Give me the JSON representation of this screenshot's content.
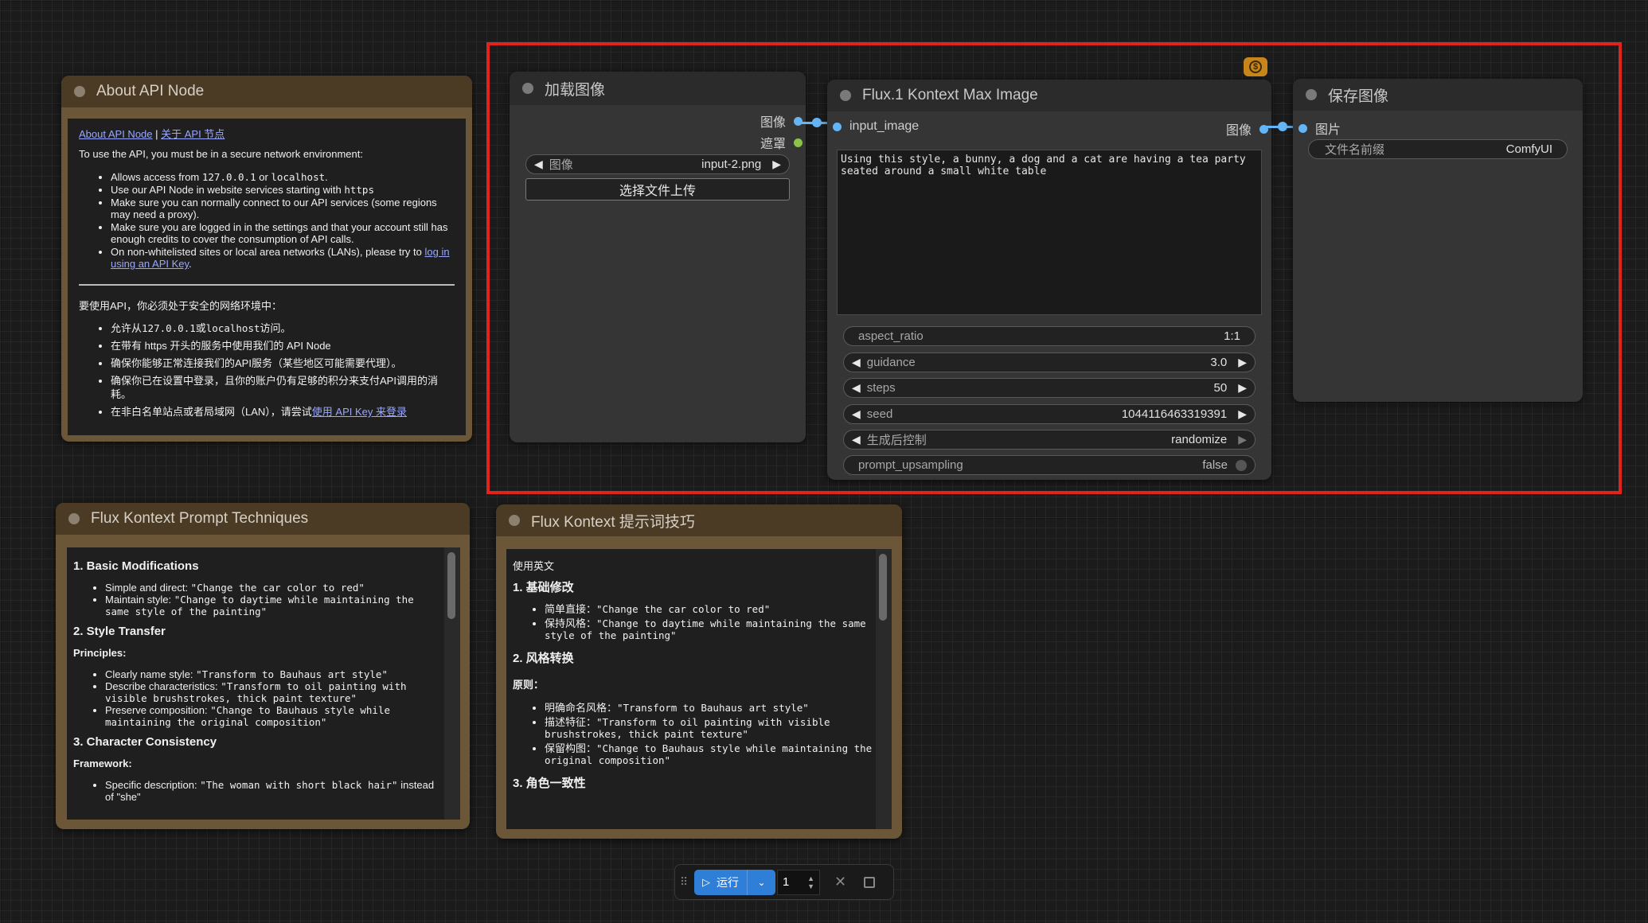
{
  "about_node": {
    "title": "About API Node",
    "link_en": "About API Node",
    "link_sep": " | ",
    "link_cn": "关于 API 节点",
    "intro": "To use the API, you must be in a secure network environment:",
    "items": [
      {
        "pre": "Allows access from ",
        "code1": "127.0.0.1",
        "mid": " or ",
        "code2": "localhost",
        "post": "."
      },
      {
        "pre": "Use our API Node in website services starting with ",
        "code1": "https",
        "mid": "",
        "code2": "",
        "post": ""
      },
      {
        "pre": "Make sure you can normally connect to our API services (some regions may need a proxy).",
        "code1": "",
        "mid": "",
        "code2": "",
        "post": ""
      },
      {
        "pre": "Make sure you are logged in in the settings and that your account still has enough credits to cover the consumption of API calls.",
        "code1": "",
        "mid": "",
        "code2": "",
        "post": ""
      }
    ],
    "last_item_pre": "On non-whitelisted sites or local area networks (LANs), please try to ",
    "last_item_link": "log in using an API Key",
    "last_item_post": ".",
    "cn_intro": "要使用API，你必须处于安全的网络环境中：",
    "cn_items": [
      {
        "pre": "允许从",
        "code1": "127.0.0.1",
        "mid": "或",
        "code2": "localhost",
        "post": "访问。"
      },
      {
        "pre": "在带有 https 开头的服务中使用我们的 API Node",
        "code1": "",
        "mid": "",
        "code2": "",
        "post": ""
      },
      {
        "pre": "确保你能够正常连接我们的API服务（某些地区可能需要代理）。",
        "code1": "",
        "mid": "",
        "code2": "",
        "post": ""
      },
      {
        "pre": "确保你已在设置中登录，且你的账户仍有足够的积分来支付API调用的消耗。",
        "code1": "",
        "mid": "",
        "code2": "",
        "post": ""
      }
    ],
    "cn_last_pre": "在非白名单站点或者局域网（LAN），请尝试",
    "cn_last_link": "使用 API Key 来登录"
  },
  "load_image_node": {
    "title": "加载图像",
    "output_image": "图像",
    "output_mask": "遮罩",
    "image_widget_label": "图像",
    "image_widget_value": "input-2.png",
    "upload_button": "选择文件上传"
  },
  "flux_node": {
    "title": "Flux.1 Kontext Max Image",
    "input_label": "input_image",
    "output_label": "图像",
    "prompt": "Using this style, a bunny, a dog and a cat are having a tea party seated around a small white table",
    "widgets": [
      {
        "label": "aspect_ratio",
        "value": "1:1",
        "arrows": false
      },
      {
        "label": "guidance",
        "value": "3.0",
        "arrows": true
      },
      {
        "label": "steps",
        "value": "50",
        "arrows": true
      },
      {
        "label": "seed",
        "value": "1044116463319391",
        "arrows": true
      },
      {
        "label": "生成后控制",
        "value": "randomize",
        "arrows": true
      }
    ],
    "toggle_label": "prompt_upsampling",
    "toggle_value": "false",
    "badge_icon": "dollar-icon",
    "badge_symbol": "$"
  },
  "save_node": {
    "title": "保存图像",
    "input_label": "图片",
    "prefix_label": "文件名前缀",
    "prefix_value": "ComfyUI"
  },
  "tech_en_node": {
    "title": "Flux Kontext Prompt Techniques",
    "h1": "1. Basic Modifications",
    "h1_items": [
      {
        "label": "Simple and direct: ",
        "code": "\"Change the car color to red\""
      },
      {
        "label": "Maintain style: ",
        "code": "\"Change to daytime while maintaining the same style of the painting\""
      }
    ],
    "h2": "2. Style Transfer",
    "h2_sub": "Principles:",
    "h2_items": [
      {
        "label": "Clearly name style: ",
        "code": "\"Transform to Bauhaus art style\""
      },
      {
        "label": "Describe characteristics: ",
        "code": "\"Transform to oil painting with visible brushstrokes, thick paint texture\""
      },
      {
        "label": "Preserve composition: ",
        "code": "\"Change to Bauhaus style while maintaining the original composition\""
      }
    ],
    "h3": "3. Character Consistency",
    "h3_sub": "Framework:",
    "h3_items": [
      {
        "label": "Specific description: ",
        "code": "\"The woman with short black hair\"",
        "post": " instead of \"she\""
      }
    ]
  },
  "tech_cn_node": {
    "title": "Flux Kontext 提示词技巧",
    "intro": "使用英文",
    "h1": "1. 基础修改",
    "h1_items": [
      {
        "label": "简单直接：",
        "code": "\"Change the car color to red\""
      },
      {
        "label": "保持风格：",
        "code": "\"Change to daytime while maintaining the same style of the painting\""
      }
    ],
    "h2": "2. 风格转换",
    "h2_sub": "原则：",
    "h2_items": [
      {
        "label": "明确命名风格：",
        "code": "\"Transform to Bauhaus art style\""
      },
      {
        "label": "描述特征：",
        "code": "\"Transform to oil painting with visible brushstrokes, thick paint texture\""
      },
      {
        "label": "保留构图：",
        "code": "\"Change to Bauhaus style while maintaining the original composition\""
      }
    ],
    "h3": "3. 角色一致性"
  },
  "toolbar": {
    "grip_icon": "drag-handle-icon",
    "run_label": "运行",
    "run_icon": "play-icon",
    "dropdown_icon": "chevron-down-icon",
    "batch_count": "1",
    "clear_icon": "close-icon",
    "stop_icon": "square-icon"
  }
}
